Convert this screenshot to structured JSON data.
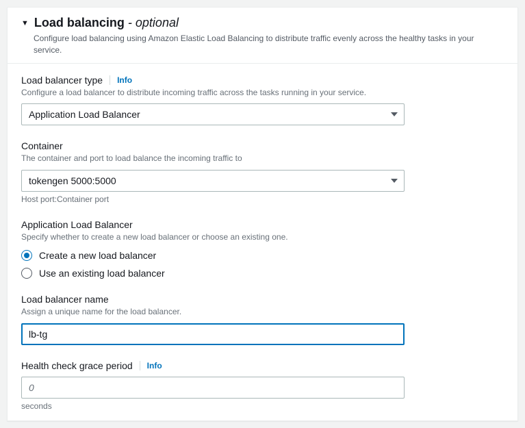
{
  "panel": {
    "title_main": "Load balancing",
    "title_dash": " - ",
    "title_optional": "optional",
    "description": "Configure load balancing using Amazon Elastic Load Balancing to distribute traffic evenly across the healthy tasks in your service."
  },
  "lb_type": {
    "label": "Load balancer type",
    "info": "Info",
    "description": "Configure a load balancer to distribute incoming traffic across the tasks running in your service.",
    "value": "Application Load Balancer"
  },
  "container": {
    "label": "Container",
    "description": "The container and port to load balance the incoming traffic to",
    "value": "tokengen 5000:5000",
    "hint": "Host port:Container port"
  },
  "alb_section": {
    "label": "Application Load Balancer",
    "description": "Specify whether to create a new load balancer or choose an existing one.",
    "option_create": "Create a new load balancer",
    "option_existing": "Use an existing load balancer"
  },
  "lb_name": {
    "label": "Load balancer name",
    "description": "Assign a unique name for the load balancer.",
    "value": "lb-tg"
  },
  "health_check": {
    "label": "Health check grace period",
    "info": "Info",
    "placeholder": "0",
    "unit": "seconds"
  }
}
